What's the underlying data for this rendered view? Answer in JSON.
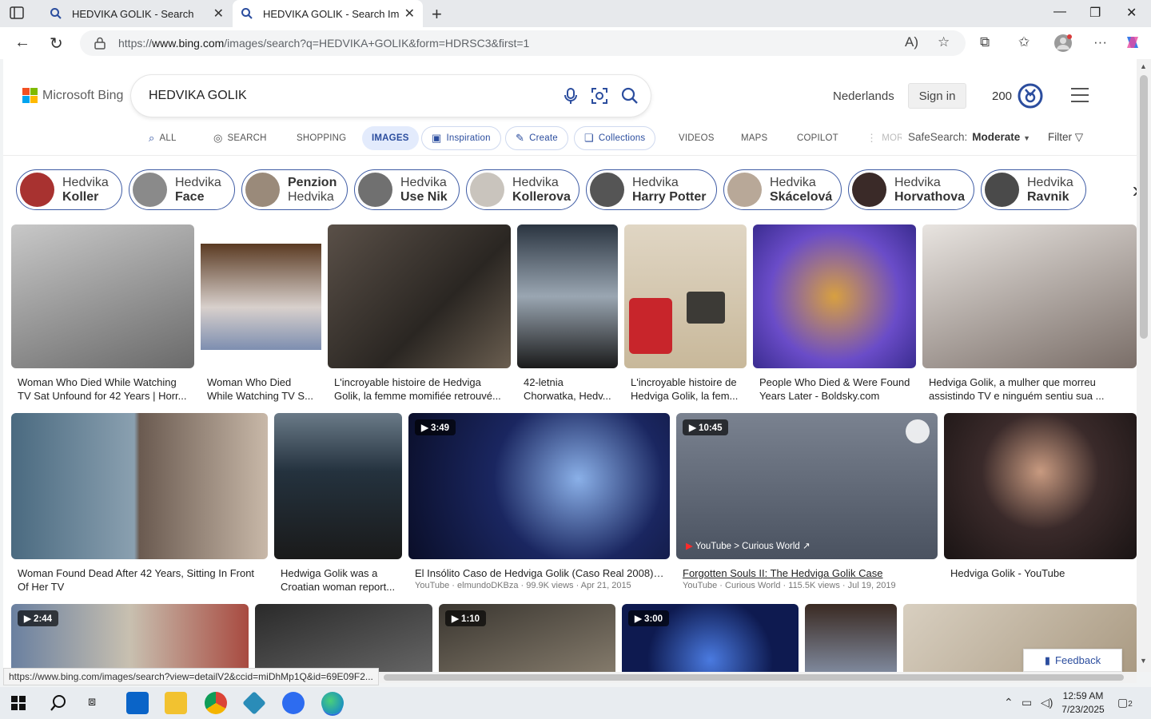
{
  "browser": {
    "tabs": [
      {
        "title": "HEDVIKA GOLIK - Search",
        "active": false
      },
      {
        "title": "HEDVIKA GOLIK - Search Images",
        "active": true
      }
    ],
    "url_prefix": "https://",
    "url_host": "www.bing.com",
    "url_path": "/images/search?q=HEDVIKA+GOLIK&form=HDRSC3&first=1",
    "status_url": "https://www.bing.com/images/search?view=detailV2&ccid=miDhMp1Q&id=69E09F2..."
  },
  "header": {
    "logo_text": "Microsoft Bing",
    "query": "HEDVIKA GOLIK",
    "language_link": "Nederlands",
    "signin_label": "Sign in",
    "reward_points": "200"
  },
  "scopes": [
    {
      "label": "ALL",
      "icon": "search-icon"
    },
    {
      "label": "SEARCH",
      "icon": "copilot-search-icon"
    },
    {
      "label": "SHOPPING"
    },
    {
      "label": "IMAGES",
      "active": true
    },
    {
      "label": "Inspiration",
      "icon": "inspiration-icon"
    },
    {
      "label": "Create",
      "icon": "create-icon"
    },
    {
      "label": "Collections",
      "icon": "collections-icon"
    },
    {
      "label": "VIDEOS"
    },
    {
      "label": "MAPS"
    },
    {
      "label": "COPILOT"
    },
    {
      "label": "MORE"
    }
  ],
  "safesearch": {
    "label": "SafeSearch:",
    "value": "Moderate"
  },
  "filter_label": "Filter",
  "related": [
    {
      "line1": "Hedvika",
      "line2": "Koller"
    },
    {
      "line1": "Hedvika",
      "line2": "Face"
    },
    {
      "line1": "Penzion",
      "line2": "Hedvika",
      "bold_first": true
    },
    {
      "line1": "Hedvika",
      "line2": "Use Nik"
    },
    {
      "line1": "Hedvika",
      "line2": "Kollerova"
    },
    {
      "line1": "Hedvika",
      "line2": "Harry Potter"
    },
    {
      "line1": "Hedvika",
      "line2": "Skácelová"
    },
    {
      "line1": "Hedvika",
      "line2": "Horvathova"
    },
    {
      "line1": "Hedvika",
      "line2": "Ravnik"
    }
  ],
  "results_row1": [
    {
      "caption": "Woman Who Died While Watching TV Sat Unfound for 42 Years | Horr...",
      "color": "#8a8a8a"
    },
    {
      "caption": "Woman Who Died While Watching TV S...",
      "color": "#6e5a4a"
    },
    {
      "caption": "L'incroyable histoire de Hedviga Golik, la femme momifiée retrouvé...",
      "color": "#3b3630"
    },
    {
      "caption": "42-letnia Chorwatka, Hedv...",
      "color": "#4a5a6a"
    },
    {
      "caption": "L'incroyable histoire de Hedviga Golik, la fem...",
      "color": "#c9b49a"
    },
    {
      "caption": "People Who Died & Were Found Years Later - Boldsky.com",
      "color": "#5a47b0"
    },
    {
      "caption": "Hedviga Golik, a mulher que morreu assistindo TV e ninguém sentiu sua ...",
      "color": "#7a6a60"
    }
  ],
  "results_row2": [
    {
      "caption": "Woman Found Dead After 42 Years, Sitting In Front Of Her TV",
      "color": "#6b8598"
    },
    {
      "caption": "Hedwiga Golik was a Croatian woman report...",
      "color": "#3d4b5a"
    },
    {
      "caption": "El Insólito Caso de Hedviga Golik (Caso Real 2008) |...",
      "color": "#1e2a5a",
      "duration": "3:49",
      "meta": "YouTube · elmundoDKBza · 99.9K views · Apr 21, 2015"
    },
    {
      "caption": "Forgotten Souls II: The Hedviga Golik Case",
      "color": "#5a6270",
      "duration": "10:45",
      "meta": "YouTube · Curious World · 115.5K views · Jul 19, 2019",
      "source": "YouTube > Curious World",
      "underline": true
    },
    {
      "caption": "Hedviga Golik - YouTube",
      "color": "#2a2020"
    }
  ],
  "results_row3": [
    {
      "duration": "2:44",
      "color": "#6d7f9a"
    },
    {
      "color": "#3a3a3a"
    },
    {
      "duration": "1:10",
      "color": "#4a4540"
    },
    {
      "duration": "3:00",
      "color": "#1c2f6a"
    },
    {
      "color": "#5a4a40"
    },
    {
      "color": "#b0a090"
    }
  ],
  "feedback_label": "Feedback",
  "taskbar": {
    "time": "12:59 AM",
    "date": "7/23/2025",
    "notification_count": "2"
  }
}
